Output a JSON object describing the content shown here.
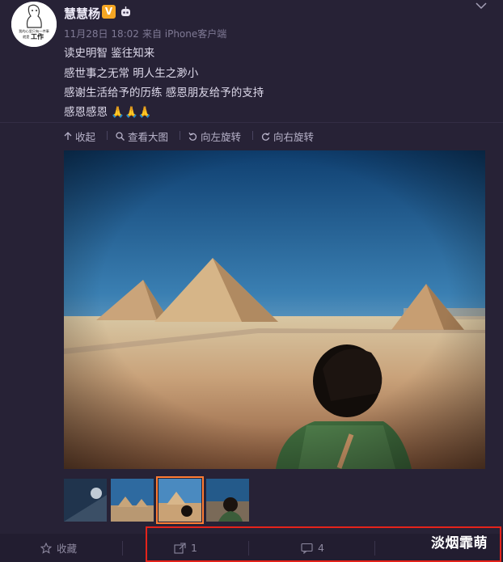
{
  "author": {
    "name": "慧慧杨",
    "avatar_text": [
      "我的心里只有一件事",
      "就是",
      "工作"
    ],
    "verified_badge": "V"
  },
  "meta": {
    "timestamp": "11月28日 18:02",
    "source": "来自 iPhone客户端"
  },
  "content": {
    "lines": [
      "读史明智 鉴往知来",
      "感世事之无常 明人生之渺小",
      "感谢生活给予的历练 感恩朋友给予的支持",
      "感恩感恩"
    ],
    "emoji": "🙏🙏🙏"
  },
  "toolbar": {
    "collapse": "收起",
    "view_large": "查看大图",
    "rotate_left": "向左旋转",
    "rotate_right": "向右旋转"
  },
  "thumbnails": {
    "count": 4,
    "selected_index": 2
  },
  "actions": {
    "favorite": "收藏",
    "repost_count": "1",
    "comment_count": "4"
  },
  "watermark": "淡烟霏萌",
  "colors": {
    "background": "#272236",
    "badge": "#f5a623",
    "selection": "#ff7d34",
    "highlight": "#e5231b"
  },
  "icons": [
    "robot-icon",
    "more-chevron-icon",
    "collapse-arrow-icon",
    "magnifier-icon",
    "rotate-left-icon",
    "rotate-right-icon",
    "star-icon",
    "repost-icon",
    "comment-icon"
  ]
}
